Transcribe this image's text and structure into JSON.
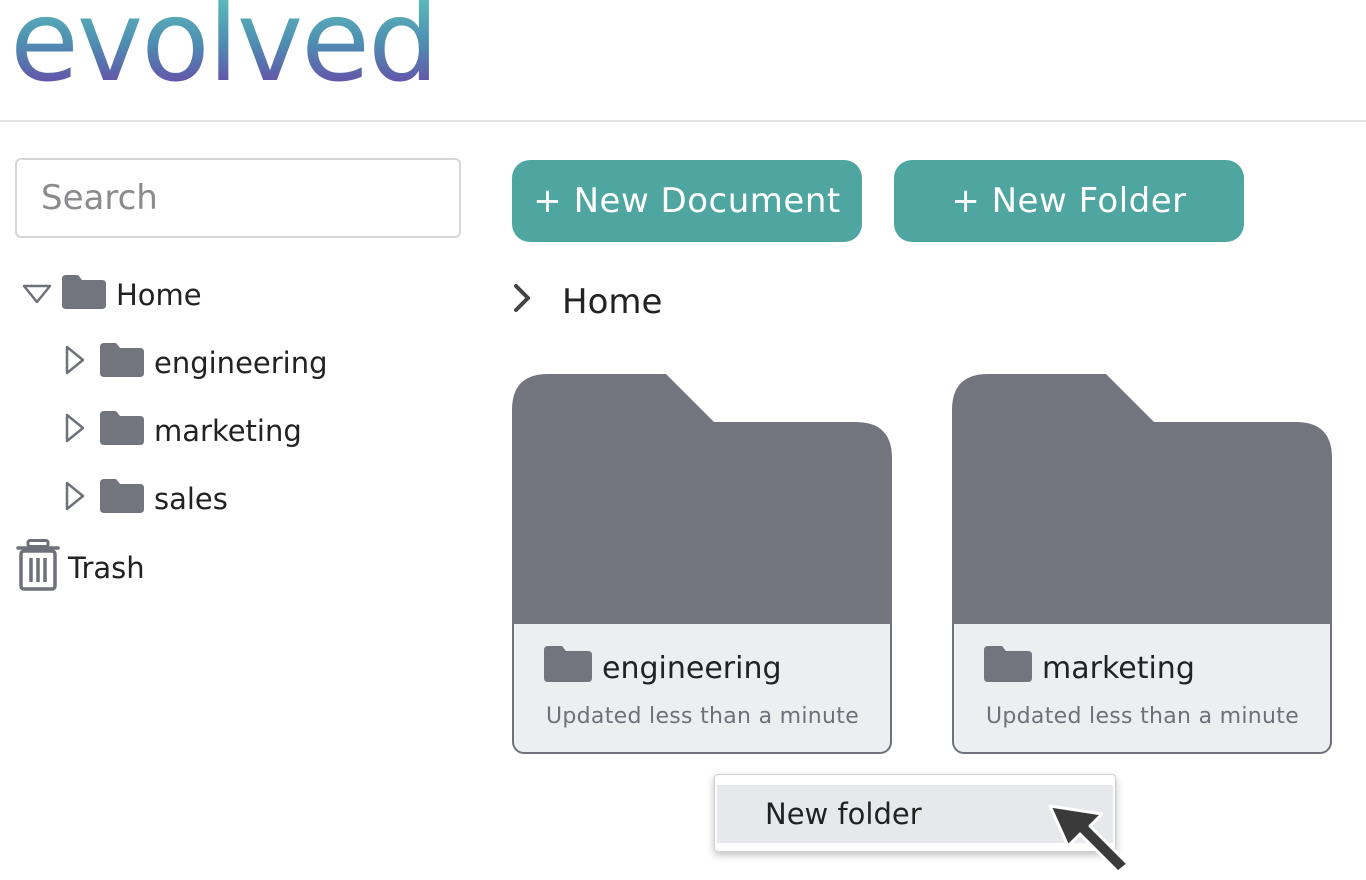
{
  "header": {
    "logo_text": "evolved"
  },
  "sidebar": {
    "search_placeholder": "Search",
    "tree": {
      "root_label": "Home",
      "children": [
        {
          "label": "engineering"
        },
        {
          "label": "marketing"
        },
        {
          "label": "sales"
        }
      ]
    },
    "trash_label": "Trash"
  },
  "toolbar": {
    "new_document_label": "+ New Document",
    "new_folder_label": "+ New Folder"
  },
  "breadcrumb": {
    "current": "Home"
  },
  "cards": [
    {
      "name": "engineering",
      "updated": "Updated less than a minute"
    },
    {
      "name": "marketing",
      "updated": "Updated less than a minute"
    }
  ],
  "context_menu": {
    "items": [
      {
        "label": "New folder"
      }
    ]
  },
  "colors": {
    "accent": "#4fa5a0",
    "folder": "#72757d",
    "card_info_bg": "#eceef2"
  },
  "icons": [
    "folder-icon",
    "triangle-down-icon",
    "triangle-right-icon",
    "chevron-right-icon",
    "trash-icon",
    "mouse-cursor-icon"
  ]
}
